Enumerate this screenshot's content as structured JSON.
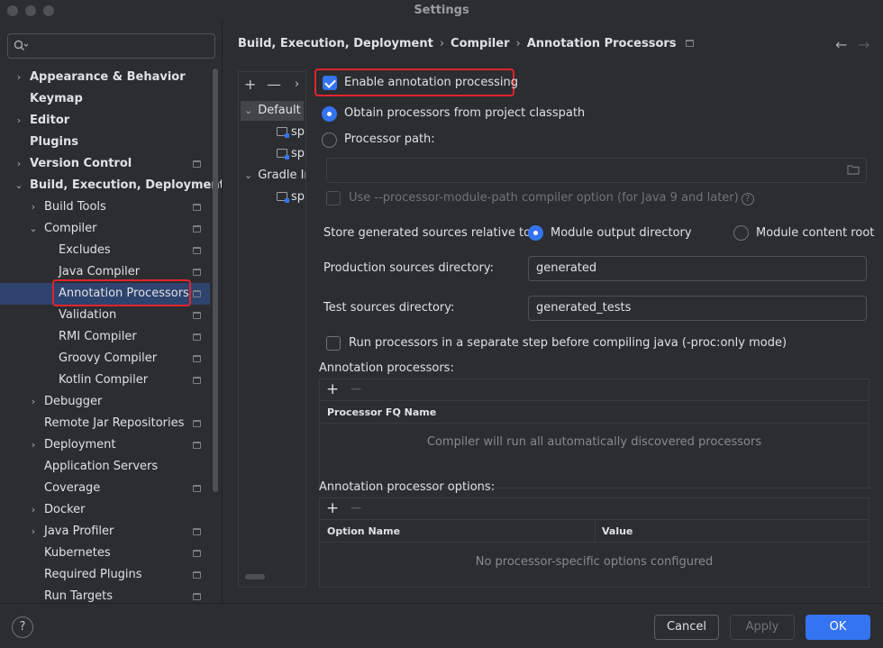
{
  "window": {
    "title": "Settings"
  },
  "search": {
    "placeholder": ""
  },
  "sidebar": {
    "items": [
      {
        "label": "Appearance & Behavior",
        "bold": true,
        "arrow": "›",
        "pin": false
      },
      {
        "label": "Keymap",
        "bold": true,
        "arrow": "",
        "pin": false
      },
      {
        "label": "Editor",
        "bold": true,
        "arrow": "›",
        "pin": false
      },
      {
        "label": "Plugins",
        "bold": true,
        "arrow": "",
        "pin": false
      },
      {
        "label": "Version Control",
        "bold": true,
        "arrow": "›",
        "pin": true
      },
      {
        "label": "Build, Execution, Deployment",
        "bold": true,
        "arrow": "⌄",
        "pin": false
      },
      {
        "label": "Build Tools",
        "bold": false,
        "arrow": "›",
        "pin": true
      },
      {
        "label": "Compiler",
        "bold": false,
        "arrow": "⌄",
        "pin": true
      },
      {
        "label": "Excludes",
        "bold": false,
        "arrow": "",
        "pin": true
      },
      {
        "label": "Java Compiler",
        "bold": false,
        "arrow": "",
        "pin": true
      },
      {
        "label": "Annotation Processors",
        "bold": false,
        "arrow": "",
        "pin": true
      },
      {
        "label": "Validation",
        "bold": false,
        "arrow": "",
        "pin": true
      },
      {
        "label": "RMI Compiler",
        "bold": false,
        "arrow": "",
        "pin": true
      },
      {
        "label": "Groovy Compiler",
        "bold": false,
        "arrow": "",
        "pin": true
      },
      {
        "label": "Kotlin Compiler",
        "bold": false,
        "arrow": "",
        "pin": true
      },
      {
        "label": "Debugger",
        "bold": false,
        "arrow": "›",
        "pin": false
      },
      {
        "label": "Remote Jar Repositories",
        "bold": false,
        "arrow": "",
        "pin": true
      },
      {
        "label": "Deployment",
        "bold": false,
        "arrow": "›",
        "pin": true
      },
      {
        "label": "Application Servers",
        "bold": false,
        "arrow": "",
        "pin": false
      },
      {
        "label": "Coverage",
        "bold": false,
        "arrow": "",
        "pin": true
      },
      {
        "label": "Docker",
        "bold": false,
        "arrow": "›",
        "pin": false
      },
      {
        "label": "Java Profiler",
        "bold": false,
        "arrow": "›",
        "pin": true
      },
      {
        "label": "Kubernetes",
        "bold": false,
        "arrow": "",
        "pin": true
      },
      {
        "label": "Required Plugins",
        "bold": false,
        "arrow": "",
        "pin": true
      },
      {
        "label": "Run Targets",
        "bold": false,
        "arrow": "",
        "pin": true
      }
    ],
    "selected": "Annotation Processors"
  },
  "breadcrumb": [
    "Build, Execution, Deployment",
    "Compiler",
    "Annotation Processors"
  ],
  "profiles": {
    "tools": [
      "+",
      "—",
      "›"
    ],
    "items": [
      {
        "label": "Default",
        "kind": "group"
      },
      {
        "label": "sp",
        "kind": "module"
      },
      {
        "label": "sp",
        "kind": "module"
      },
      {
        "label": "Gradle Ir",
        "kind": "group"
      },
      {
        "label": "sp",
        "kind": "module"
      }
    ]
  },
  "settings": {
    "enable_label": "Enable annotation processing",
    "enable_checked": true,
    "obtain_label": "Obtain processors from project classpath",
    "processor_path_label": "Processor path:",
    "processor_path_value": "",
    "module_path_label": "Use --processor-module-path compiler option (for Java 9 and later)",
    "store_label": "Store generated sources relative to:",
    "module_output_label": "Module output directory",
    "module_content_label": "Module content root",
    "production_label": "Production sources directory:",
    "production_value": "generated",
    "test_label": "Test sources directory:",
    "test_value": "generated_tests",
    "separate_step_label": "Run processors in a separate step before compiling java (-proc:only mode)"
  },
  "processors_table": {
    "title": "Annotation processors:",
    "column": "Processor FQ Name",
    "empty": "Compiler will run all automatically discovered processors"
  },
  "options_table": {
    "title": "Annotation processor options:",
    "columns": [
      "Option Name",
      "Value"
    ],
    "empty": "No processor-specific options configured"
  },
  "footer": {
    "help": "?",
    "cancel": "Cancel",
    "apply": "Apply",
    "ok": "OK"
  },
  "colors": {
    "accent": "#3574f0",
    "highlight_border": "#e0242c",
    "selection": "#2e436e"
  }
}
